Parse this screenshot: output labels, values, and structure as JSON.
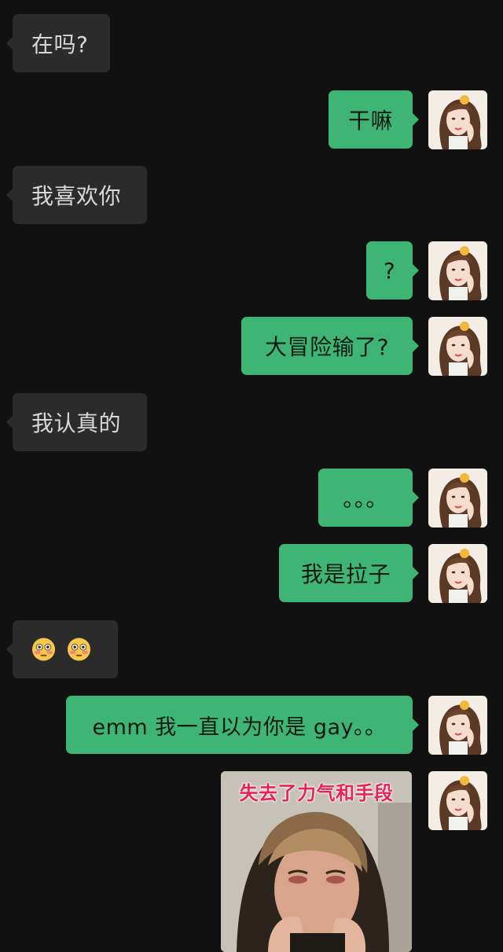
{
  "app": {
    "background_color": "#111111",
    "incoming_bubble_color": "#2b2b2b",
    "outgoing_bubble_color": "#3eb575"
  },
  "messages": [
    {
      "direction": "in",
      "type": "text",
      "text": "在吗?"
    },
    {
      "direction": "out",
      "type": "text",
      "text": "干嘛"
    },
    {
      "direction": "in",
      "type": "text",
      "text": "我喜欢你"
    },
    {
      "direction": "out",
      "type": "text",
      "text": "?"
    },
    {
      "direction": "out",
      "type": "text",
      "text": "大冒险输了?"
    },
    {
      "direction": "in",
      "type": "text",
      "text": "我认真的"
    },
    {
      "direction": "out",
      "type": "text",
      "text": "。。。"
    },
    {
      "direction": "out",
      "type": "text",
      "text": "我是拉子"
    },
    {
      "direction": "in",
      "type": "emoji",
      "emoji": [
        "flushed-face-icon",
        "flushed-face-icon"
      ]
    },
    {
      "direction": "out",
      "type": "text",
      "text": "emm 我一直以为你是 gay。。"
    },
    {
      "direction": "out",
      "type": "image",
      "caption": "失去了力气和手段"
    }
  ]
}
